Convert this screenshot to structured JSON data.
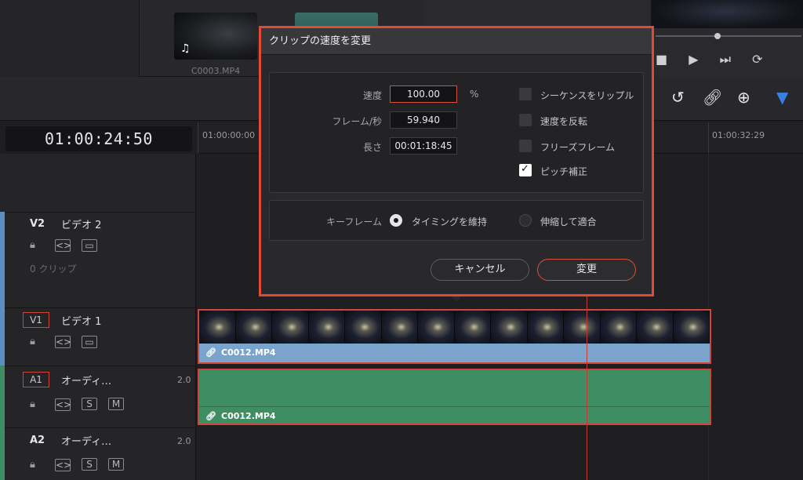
{
  "media_pool": {
    "clip1_name": "C0003.MP4",
    "clip1_icon": "music-note-icon"
  },
  "toolbar": {
    "icons": [
      "snap-icon",
      "link-icon",
      "lock-icon",
      "flag-icon"
    ]
  },
  "timeline": {
    "timecode": "01:00:24:50",
    "ruler_start": "01:00:00:00",
    "ruler_end": "01:00:32:29"
  },
  "tracks": {
    "v2": {
      "label": "V2",
      "name": "ビデオ 2",
      "clips": "0 クリップ"
    },
    "v1": {
      "label": "V1",
      "name": "ビデオ 1"
    },
    "a1": {
      "label": "A1",
      "name": "オーディ…",
      "channels": "2.0",
      "s": "S",
      "m": "M"
    },
    "a2": {
      "label": "A2",
      "name": "オーディ…",
      "channels": "2.0",
      "s": "S",
      "m": "M"
    }
  },
  "clips": {
    "video": "C0012.MP4",
    "audio": "C0012.MP4"
  },
  "dialog": {
    "title": "クリップの速度を変更",
    "speed_label": "速度",
    "speed_value": "100.00",
    "speed_unit": "%",
    "fps_label": "フレーム/秒",
    "fps_value": "59.940",
    "duration_label": "長さ",
    "duration_value": "00:01:18:45",
    "ripple_label": "シーケンスをリップル",
    "ripple_checked": false,
    "reverse_label": "速度を反転",
    "reverse_checked": false,
    "freeze_label": "フリーズフレーム",
    "freeze_checked": false,
    "pitch_label": "ピッチ補正",
    "pitch_checked": true,
    "keyframe_label": "キーフレーム",
    "keep_timing_label": "タイミングを維持",
    "keep_timing_selected": true,
    "stretch_label": "伸縮して適合",
    "stretch_selected": false,
    "cancel_label": "キャンセル",
    "change_label": "変更"
  },
  "colors": {
    "accent_red": "#d8503c",
    "video_track": "#7aa4cc",
    "audio_track": "#3f8d63"
  }
}
